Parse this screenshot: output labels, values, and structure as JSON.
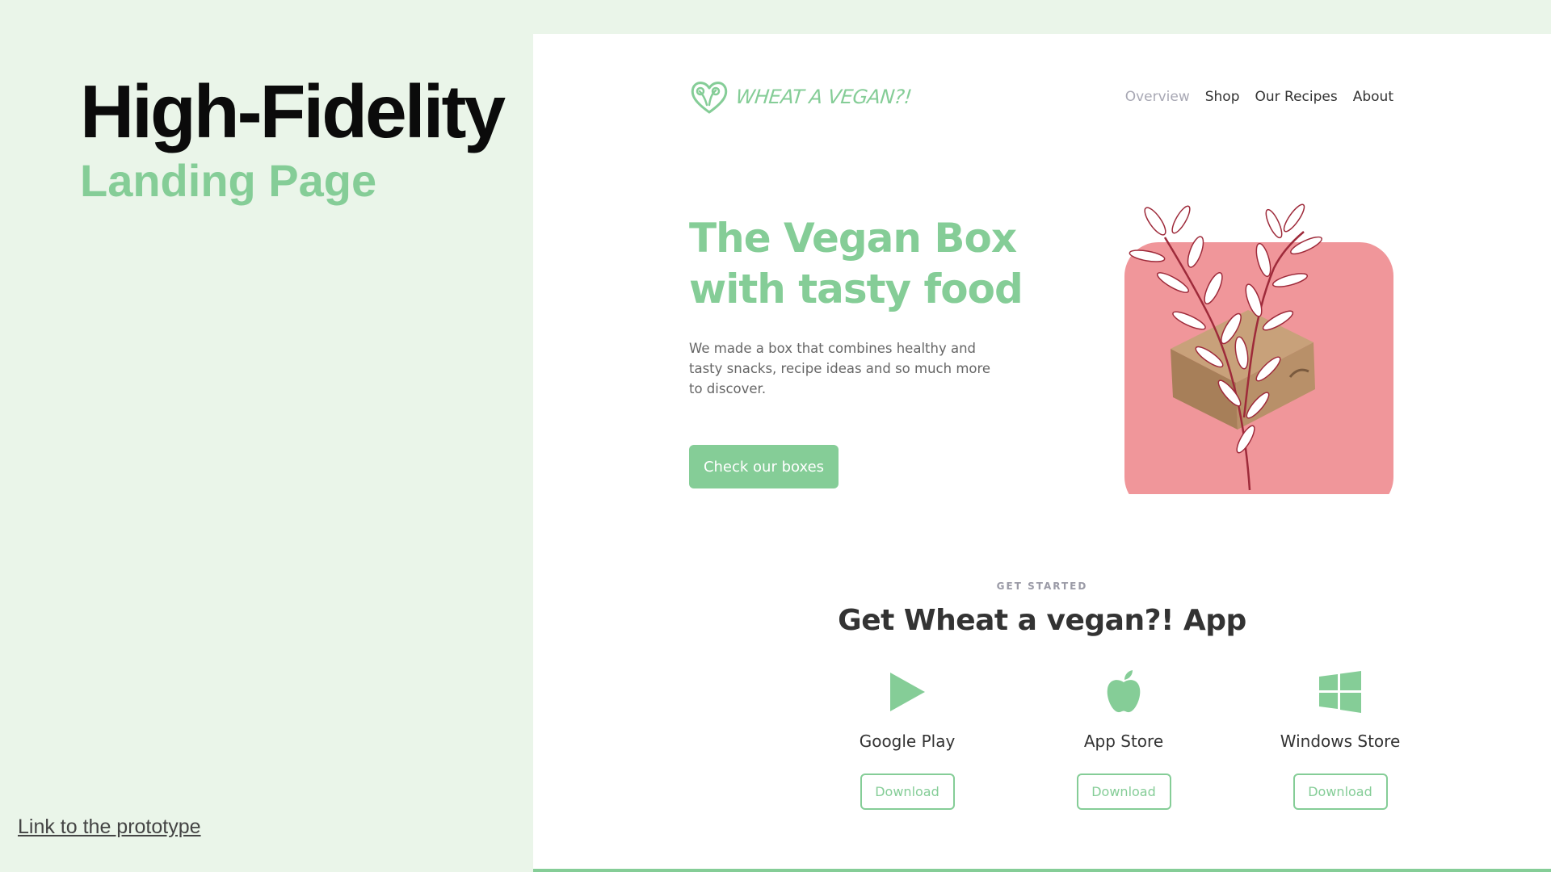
{
  "slide": {
    "title": "High-Fidelity",
    "subtitle": "Landing Page",
    "link_text": "Link to the prototype"
  },
  "site": {
    "brand": "WHEAT A VEGAN?!",
    "nav": [
      {
        "label": "Overview",
        "active": true
      },
      {
        "label": "Shop",
        "active": false
      },
      {
        "label": "Our Recipes",
        "active": false
      },
      {
        "label": "About",
        "active": false
      }
    ],
    "hero": {
      "title_line1": "The Vegan Box",
      "title_line2": "with tasty food",
      "description": "We made a box that combines healthy and tasty snacks, recipe ideas and so much more to discover.",
      "cta": "Check our boxes"
    },
    "app_section": {
      "eyebrow": "GET STARTED",
      "title": "Get Wheat a vegan?! App",
      "stores": [
        {
          "name": "Google Play",
          "button": "Download",
          "icon": "play-icon"
        },
        {
          "name": "App Store",
          "button": "Download",
          "icon": "apple-icon"
        },
        {
          "name": "Windows Store",
          "button": "Download",
          "icon": "windows-icon"
        }
      ]
    }
  },
  "colors": {
    "accent": "#85cd97",
    "background": "#eaf5e9",
    "hero_card": "#f0969a",
    "box": "#b89069",
    "leaf_stem": "#9e2a3a",
    "heading_dark": "#333333"
  }
}
